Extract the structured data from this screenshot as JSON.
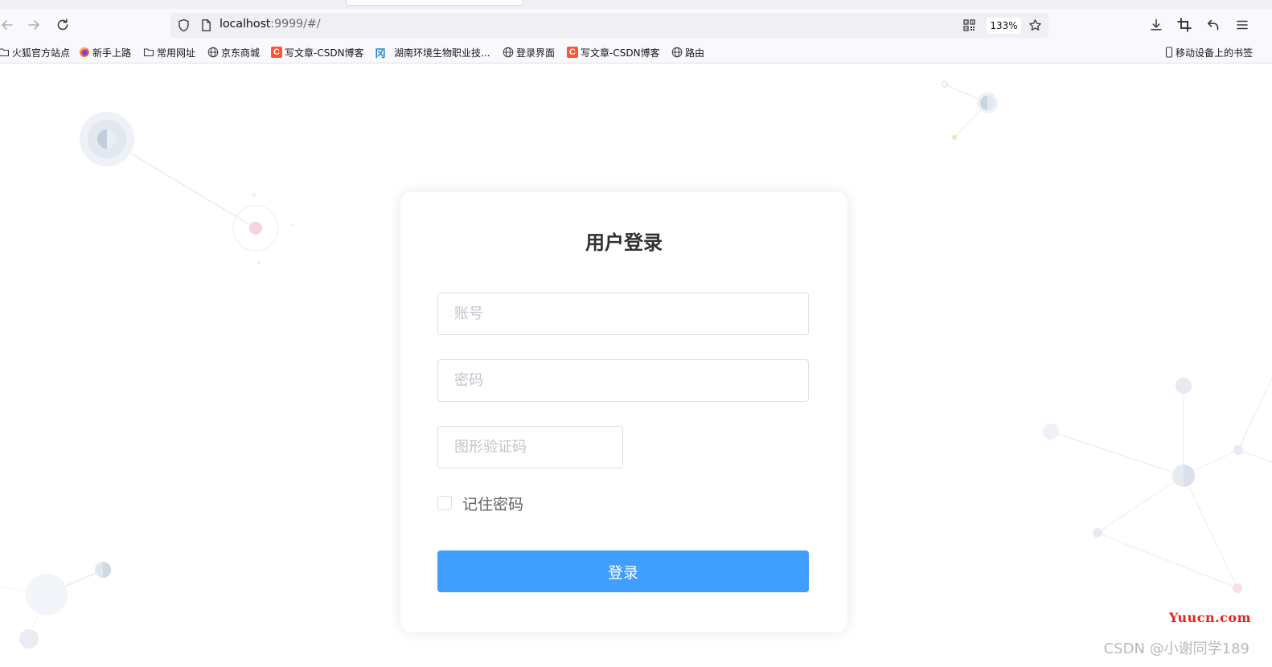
{
  "browser": {
    "nav": {
      "back_icon": "arrow-left-icon",
      "forward_icon": "arrow-right-icon",
      "reload_icon": "reload-icon"
    },
    "url_bar": {
      "host": "localhost",
      "rest": ":9999/#/",
      "zoom": "133%"
    },
    "right_toolbar_icons": [
      "download-icon",
      "crop-icon",
      "undo-icon",
      "menu-icon"
    ]
  },
  "bookmarks": [
    {
      "icon": "folder-icon",
      "label": "火狐官方站点"
    },
    {
      "icon": "firefox-icon",
      "label": "新手上路"
    },
    {
      "icon": "folder-icon",
      "label": "常用网址"
    },
    {
      "icon": "globe-icon",
      "label": "京东商城"
    },
    {
      "icon": "csdn-icon",
      "label": "写文章-CSDN博客"
    },
    {
      "icon": "hn-icon",
      "label": "湖南环境生物职业技..."
    },
    {
      "icon": "globe-icon",
      "label": "登录界面"
    },
    {
      "icon": "csdn-icon",
      "label": "写文章-CSDN博客"
    },
    {
      "icon": "globe-icon",
      "label": "路由"
    }
  ],
  "mobile_bookmarks": "移动设备上的书签",
  "login": {
    "title": "用户登录",
    "account_placeholder": "账号",
    "password_placeholder": "密码",
    "captcha_placeholder": "图形验证码",
    "remember_label": "记住密码",
    "remember_checked": false,
    "submit_label": "登录",
    "accent_color": "#409eff"
  },
  "watermarks": {
    "site": "Yuucn.com",
    "author": "CSDN @小谢同学189"
  }
}
